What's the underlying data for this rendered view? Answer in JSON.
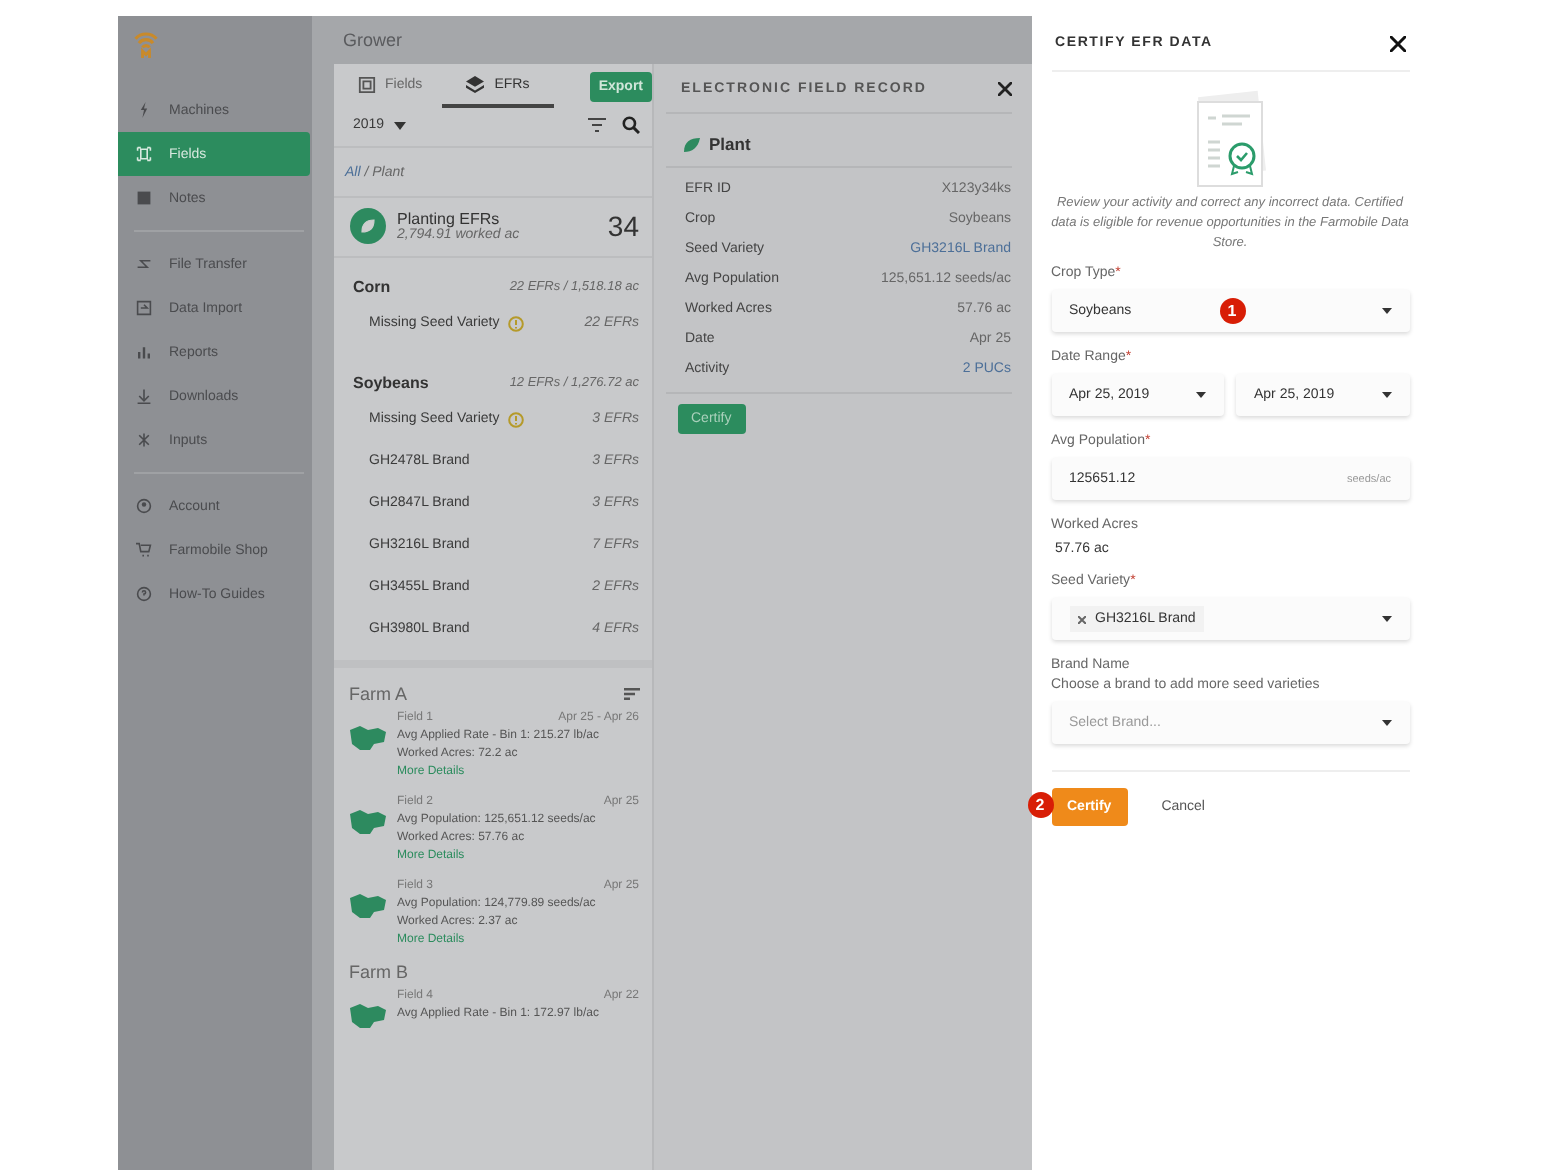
{
  "app_header": {
    "title": "Grower"
  },
  "sidebar": {
    "groups": [
      [
        {
          "label": "Machines",
          "kind": "bolt",
          "selected": false
        },
        {
          "label": "Fields",
          "kind": "field",
          "selected": true
        },
        {
          "label": "Notes",
          "kind": "note",
          "selected": false
        }
      ],
      [
        {
          "label": "File Transfer",
          "kind": "transfer",
          "selected": false
        },
        {
          "label": "Data Import",
          "kind": "import",
          "selected": false
        },
        {
          "label": "Reports",
          "kind": "chart",
          "selected": false
        },
        {
          "label": "Downloads",
          "kind": "download",
          "selected": false
        },
        {
          "label": "Inputs",
          "kind": "inputs",
          "selected": false
        }
      ],
      [
        {
          "label": "Account",
          "kind": "account",
          "selected": false
        },
        {
          "label": "Farmobile Shop",
          "kind": "cart",
          "selected": false
        },
        {
          "label": "How-To Guides",
          "kind": "help",
          "selected": false
        }
      ]
    ]
  },
  "list_panel": {
    "tabs": [
      {
        "label": "Fields",
        "kind": "field",
        "selected": false
      },
      {
        "label": "EFRs",
        "kind": "layers",
        "selected": true
      }
    ],
    "export_button": "Export",
    "year": "2019",
    "breadcrumb": {
      "link": "All",
      "current": "/ Plant"
    },
    "summary": {
      "title": "Planting EFRs",
      "subtitle": "2,794.91 worked ac",
      "count": "34"
    },
    "crops": [
      {
        "name": "Corn",
        "summary": "22 EFRs / 1,518.18 ac",
        "rows": [
          {
            "label": "Missing Seed Variety",
            "warning": true,
            "count": "22 EFRs"
          }
        ]
      },
      {
        "name": "Soybeans",
        "summary": "12 EFRs / 1,276.72 ac",
        "rows": [
          {
            "label": "Missing Seed Variety",
            "warning": true,
            "count": "3 EFRs"
          },
          {
            "label": "GH2478L Brand",
            "warning": false,
            "count": "3 EFRs"
          },
          {
            "label": "GH2847L Brand",
            "warning": false,
            "count": "3 EFRs"
          },
          {
            "label": "GH3216L Brand",
            "warning": false,
            "count": "7 EFRs"
          },
          {
            "label": "GH3455L Brand",
            "warning": false,
            "count": "2 EFRs"
          },
          {
            "label": "GH3980L Brand",
            "warning": false,
            "count": "4 EFRs"
          }
        ]
      }
    ],
    "farms": [
      {
        "name": "Farm A",
        "fields": [
          {
            "name": "Field 1",
            "date": "Apr 25 - Apr 26",
            "lines": [
              "Avg Applied Rate - Bin 1: 215.27 lb/ac",
              "Worked Acres: 72.2 ac"
            ],
            "link": "More Details"
          },
          {
            "name": "Field 2",
            "date": "Apr 25",
            "lines": [
              "Avg Population: 125,651.12 seeds/ac",
              "Worked Acres: 57.76 ac"
            ],
            "link": "More Details"
          },
          {
            "name": "Field 3",
            "date": "Apr 25",
            "lines": [
              "Avg Population: 124,779.89 seeds/ac",
              "Worked Acres: 2.37 ac"
            ],
            "link": "More Details"
          }
        ]
      },
      {
        "name": "Farm B",
        "fields": [
          {
            "name": "Field 4",
            "date": "Apr 22",
            "lines": [
              "Avg Applied Rate - Bin 1: 172.97 lb/ac"
            ]
          }
        ]
      }
    ]
  },
  "efr_panel": {
    "title": "ELECTRONIC FIELD RECORD",
    "section": "Plant",
    "rows": [
      {
        "label": "EFR ID",
        "value": "X123y34ks",
        "kind": "text"
      },
      {
        "label": "Crop",
        "value": "Soybeans",
        "kind": "text"
      },
      {
        "label": "Seed Variety",
        "value": "GH3216L Brand",
        "kind": "link"
      },
      {
        "label": "Avg Population",
        "value": "125,651.12 seeds/ac",
        "kind": "text"
      },
      {
        "label": "Worked Acres",
        "value": "57.76 ac",
        "kind": "text"
      },
      {
        "label": "Date",
        "value": "Apr 25",
        "kind": "text"
      },
      {
        "label": "Activity",
        "value": "2 PUCs",
        "kind": "link"
      }
    ],
    "button": "Certify"
  },
  "certify_panel": {
    "title": "CERTIFY EFR DATA",
    "description": "Review your activity and correct any incorrect data. Certified data is eligible for revenue opportunities in the Farmobile Data Store.",
    "fields": [
      {
        "kind": "select",
        "label": "Crop Type",
        "required_mark": "*",
        "value": "Soybeans",
        "marker": "1"
      },
      {
        "kind": "date_range",
        "label": "Date Range",
        "required_mark": "*",
        "values": [
          "Apr 25, 2019",
          "Apr 25, 2019"
        ]
      },
      {
        "kind": "input",
        "label": "Avg Population",
        "required_mark": "*",
        "value": "125651.12",
        "unit": "seeds/ac"
      },
      {
        "kind": "static",
        "label": "Worked Acres",
        "value": "57.76 ac"
      },
      {
        "kind": "multiselect",
        "label": "Seed Variety",
        "required_mark": "*",
        "chips": [
          "GH3216L Brand"
        ]
      },
      {
        "kind": "select",
        "label": "Brand Name",
        "hint": "Choose a brand to add more seed varieties",
        "placeholder": "Select Brand..."
      }
    ],
    "submit": {
      "label": "Certify",
      "marker": "2"
    },
    "cancel": "Cancel"
  }
}
